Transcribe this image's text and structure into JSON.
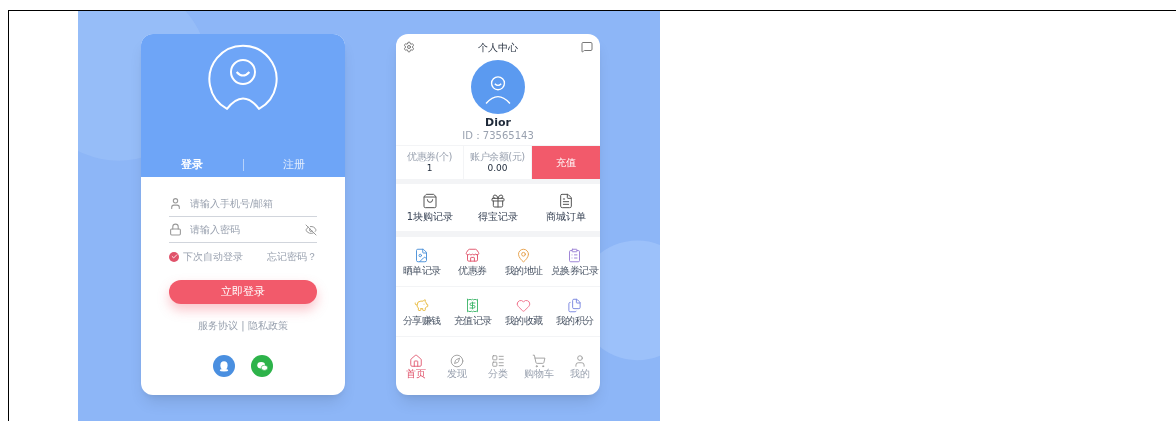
{
  "login": {
    "tabs": [
      {
        "label": "登录",
        "selected": true
      },
      {
        "label": "注册",
        "selected": false
      }
    ],
    "fields": [
      {
        "kind": "user",
        "placeholder": "请输入手机号/邮箱"
      },
      {
        "kind": "password",
        "placeholder": "请输入密码"
      }
    ],
    "remember": {
      "label": "下次自动登录",
      "checked": true
    },
    "forgot": "忘记密码？",
    "submit": "立即登录",
    "links": "服务协议 | 隐私政策",
    "social": [
      {
        "kind": "qq"
      },
      {
        "kind": "wechat"
      }
    ]
  },
  "profile": {
    "title": "个人中心",
    "name": "Dior",
    "id": "ID：73565143",
    "stats": [
      {
        "label": "优惠券(个)",
        "value": "1"
      },
      {
        "label": "账户余额(元)",
        "value": "0.00"
      }
    ],
    "action": "充值",
    "main_menu": [
      {
        "kind": "bag",
        "label": "1块购记录"
      },
      {
        "kind": "gift",
        "label": "得宝记录"
      },
      {
        "kind": "doc",
        "label": "商城订单"
      }
    ],
    "services": [
      [
        {
          "kind": "photo",
          "label": "晒单记录"
        },
        {
          "kind": "coupon",
          "label": "优惠券"
        },
        {
          "kind": "pin",
          "label": "我的地址"
        },
        {
          "kind": "clipboard",
          "label": "兑换券记录"
        }
      ],
      [
        {
          "kind": "piggy",
          "label": "分享赚钱"
        },
        {
          "kind": "receipt",
          "label": "充值记录"
        },
        {
          "kind": "heart",
          "label": "我的收藏"
        },
        {
          "kind": "files",
          "label": "我的积分"
        }
      ]
    ],
    "tabbar": [
      {
        "kind": "home",
        "label": "首页",
        "selected": true
      },
      {
        "kind": "discover",
        "label": "发现",
        "selected": false
      },
      {
        "kind": "category",
        "label": "分类",
        "selected": false
      },
      {
        "kind": "cart",
        "label": "购物车",
        "selected": false
      },
      {
        "kind": "me",
        "label": "我的",
        "selected": false
      }
    ]
  }
}
